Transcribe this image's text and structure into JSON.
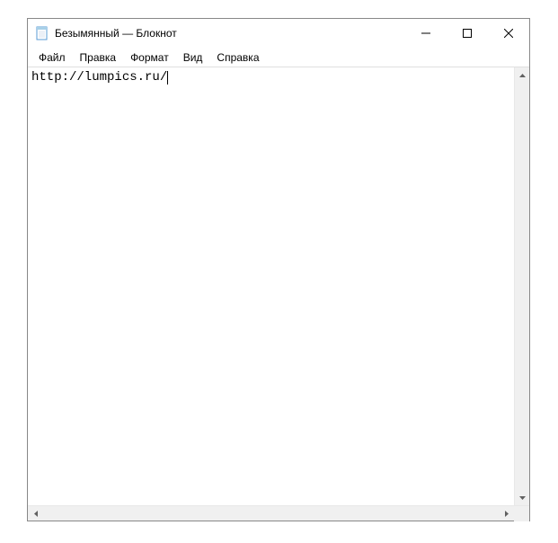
{
  "window": {
    "title": "Безымянный — Блокнот"
  },
  "menubar": {
    "items": [
      {
        "label": "Файл"
      },
      {
        "label": "Правка"
      },
      {
        "label": "Формат"
      },
      {
        "label": "Вид"
      },
      {
        "label": "Справка"
      }
    ]
  },
  "editor": {
    "content": "http://lumpics.ru/"
  }
}
